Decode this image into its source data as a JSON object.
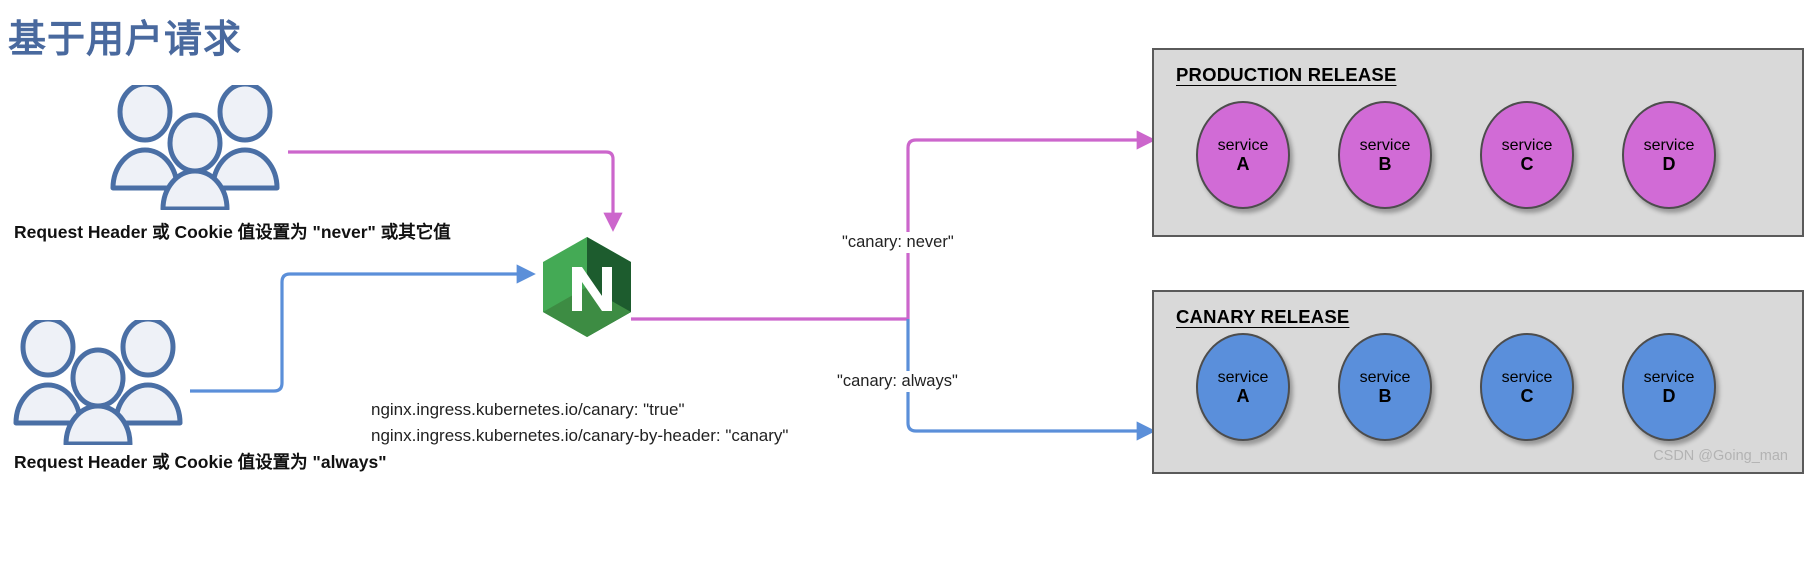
{
  "title": "基于用户请求",
  "colors": {
    "title": "#49699e",
    "production_node": "#d16bd6",
    "canary_node": "#5a8fdb",
    "production_edge": "#cc66cc",
    "canary_edge": "#5b8fd9",
    "box_fill": "#d9d9d9",
    "box_border": "#5a5a5a",
    "user_icon_stroke": "#4a6fa5",
    "user_icon_fill": "#eef1f7",
    "nginx_green_light": "#44aa55",
    "nginx_green_mid": "#3d8c43",
    "nginx_green_dark": "#1d5c2e"
  },
  "users": [
    {
      "id": "users-top",
      "icon": "users-group-icon",
      "caption": "Request Header 或 Cookie 值设置为 \"never\" 或其它值"
    },
    {
      "id": "users-bottom",
      "icon": "users-group-icon",
      "caption": "Request Header 或 Cookie 值设置为 \"always\""
    }
  ],
  "gateway": {
    "icon": "nginx-logo-icon",
    "name": "nginx"
  },
  "annotations": [
    "nginx.ingress.kubernetes.io/canary: \"true\"",
    "nginx.ingress.kubernetes.io/canary-by-header: \"canary\""
  ],
  "edge_labels": {
    "production": "\"canary: never\"",
    "canary": "\"canary: always\""
  },
  "releases": [
    {
      "id": "production",
      "title": "PRODUCTION RELEASE",
      "services": [
        {
          "word": "service",
          "letter": "A"
        },
        {
          "word": "service",
          "letter": "B"
        },
        {
          "word": "service",
          "letter": "C"
        },
        {
          "word": "service",
          "letter": "D"
        }
      ]
    },
    {
      "id": "canary",
      "title": "CANARY RELEASE",
      "services": [
        {
          "word": "service",
          "letter": "A"
        },
        {
          "word": "service",
          "letter": "B"
        },
        {
          "word": "service",
          "letter": "C"
        },
        {
          "word": "service",
          "letter": "D"
        }
      ]
    }
  ],
  "watermark": "CSDN @Going_man"
}
